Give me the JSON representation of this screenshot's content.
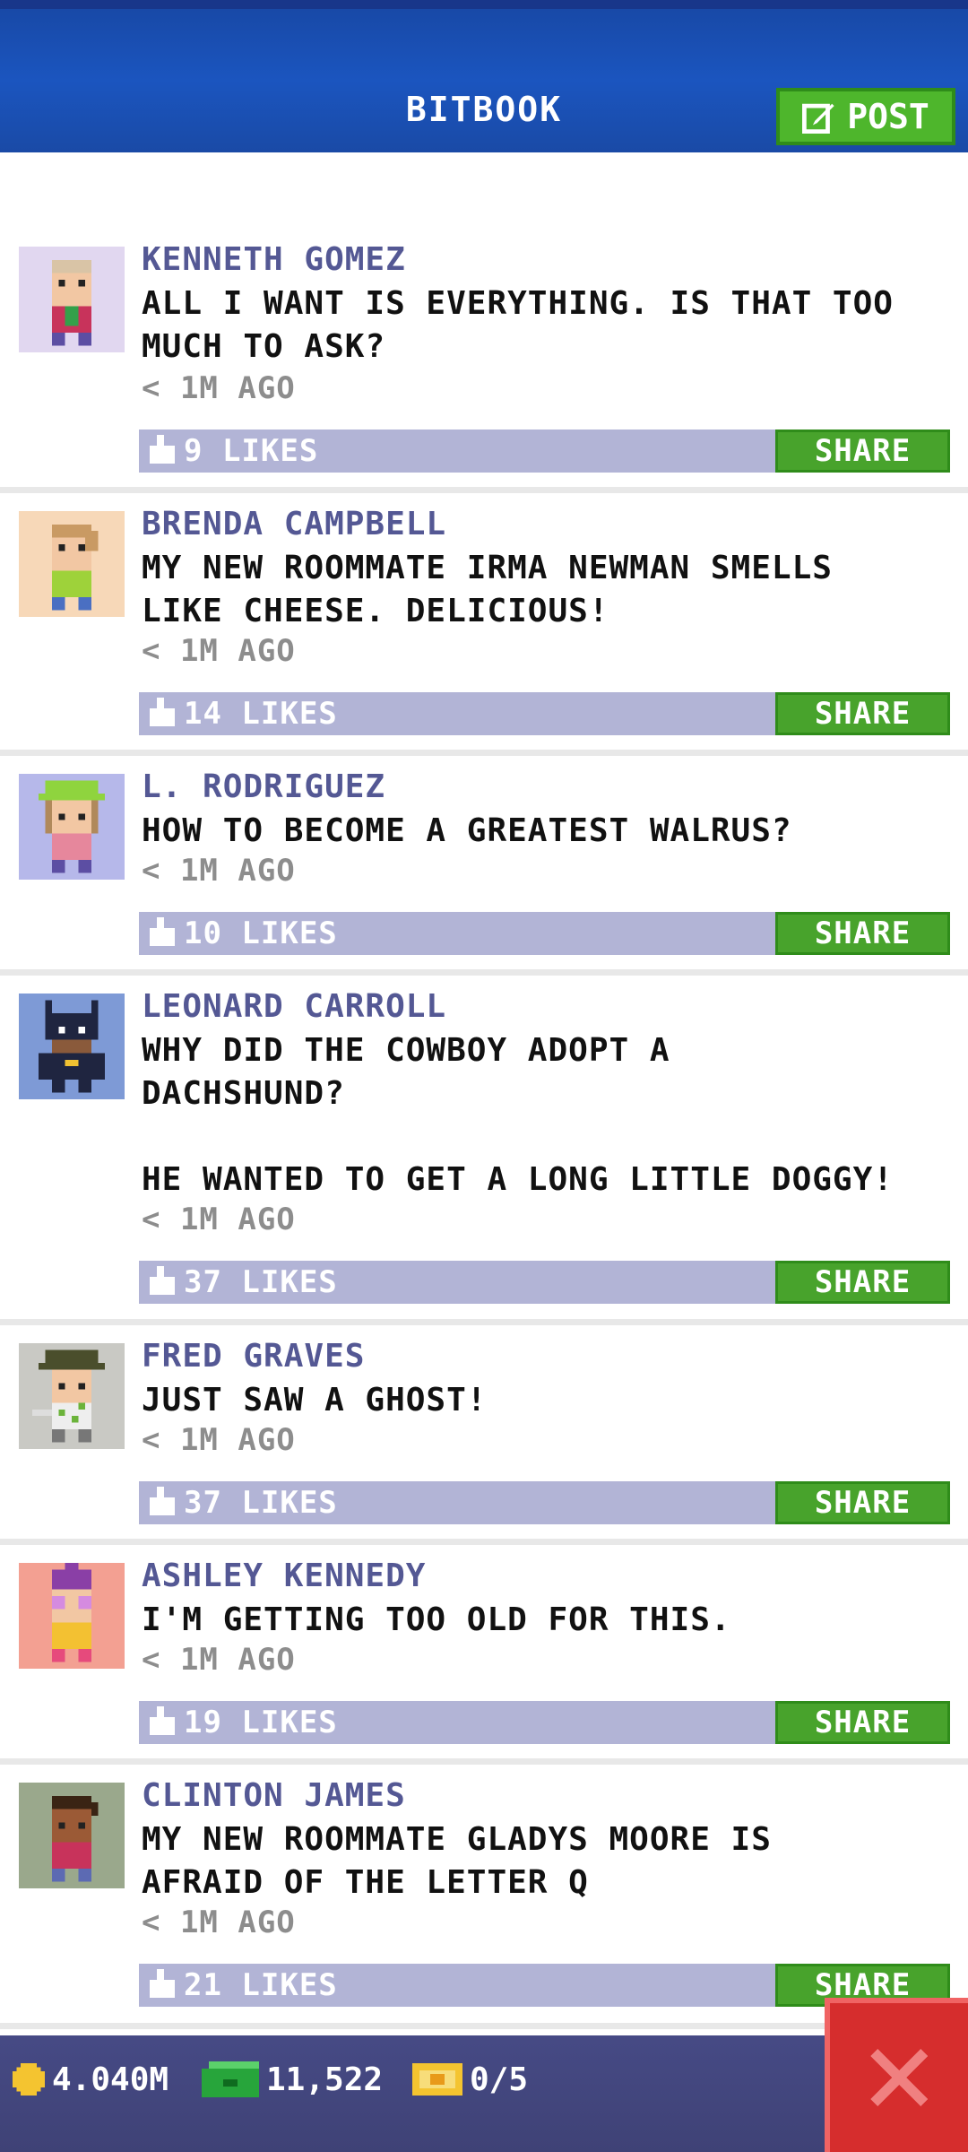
{
  "header": {
    "title": "BITBOOK",
    "post_label": "POST"
  },
  "posts": [
    {
      "name": "KENNETH GOMEZ",
      "message": "ALL I WANT IS EVERYTHING. IS THAT TOO\nMUCH TO ASK?",
      "time": "< 1M AGO",
      "likes": "9 LIKES",
      "share": "SHARE",
      "avatar_bg": "#e1d7f0"
    },
    {
      "name": "BRENDA CAMPBELL",
      "message": "MY NEW ROOMMATE IRMA NEWMAN SMELLS\nLIKE CHEESE. DELICIOUS!",
      "time": "< 1M AGO",
      "likes": "14 LIKES",
      "share": "SHARE",
      "avatar_bg": "#f7d8b8"
    },
    {
      "name": "L. RODRIGUEZ",
      "message": "HOW TO BECOME A GREATEST WALRUS?",
      "time": "< 1M AGO",
      "likes": "10 LIKES",
      "share": "SHARE",
      "avatar_bg": "#b6b8ea"
    },
    {
      "name": "LEONARD CARROLL",
      "message": "WHY DID THE COWBOY ADOPT A\nDACHSHUND?\n\nHE WANTED TO GET A LONG LITTLE DOGGY!",
      "time": "< 1M AGO",
      "likes": "37 LIKES",
      "share": "SHARE",
      "avatar_bg": "#7e9ad6"
    },
    {
      "name": "FRED GRAVES",
      "message": "JUST SAW A GHOST!",
      "time": "< 1M AGO",
      "likes": "37 LIKES",
      "share": "SHARE",
      "avatar_bg": "#c9c9c4"
    },
    {
      "name": "ASHLEY KENNEDY",
      "message": "I'M GETTING TOO OLD FOR THIS.",
      "time": "< 1M AGO",
      "likes": "19 LIKES",
      "share": "SHARE",
      "avatar_bg": "#f3a092"
    },
    {
      "name": "CLINTON JAMES",
      "message": "MY NEW ROOMMATE GLADYS MOORE IS\nAFRAID OF THE LETTER Q",
      "time": "< 1M AGO",
      "likes": "21 LIKES",
      "share": "SHARE",
      "avatar_bg": "#9aa88c"
    }
  ],
  "bottom_bar": {
    "coins": "4.040M",
    "bux": "11,522",
    "tickets": "0/5"
  },
  "colors": {
    "header_blue": "#1b55bf",
    "share_green": "#48a32c",
    "like_bar": "#b2b4d6",
    "name_purple": "#545894",
    "close_red": "#d62d2d"
  }
}
